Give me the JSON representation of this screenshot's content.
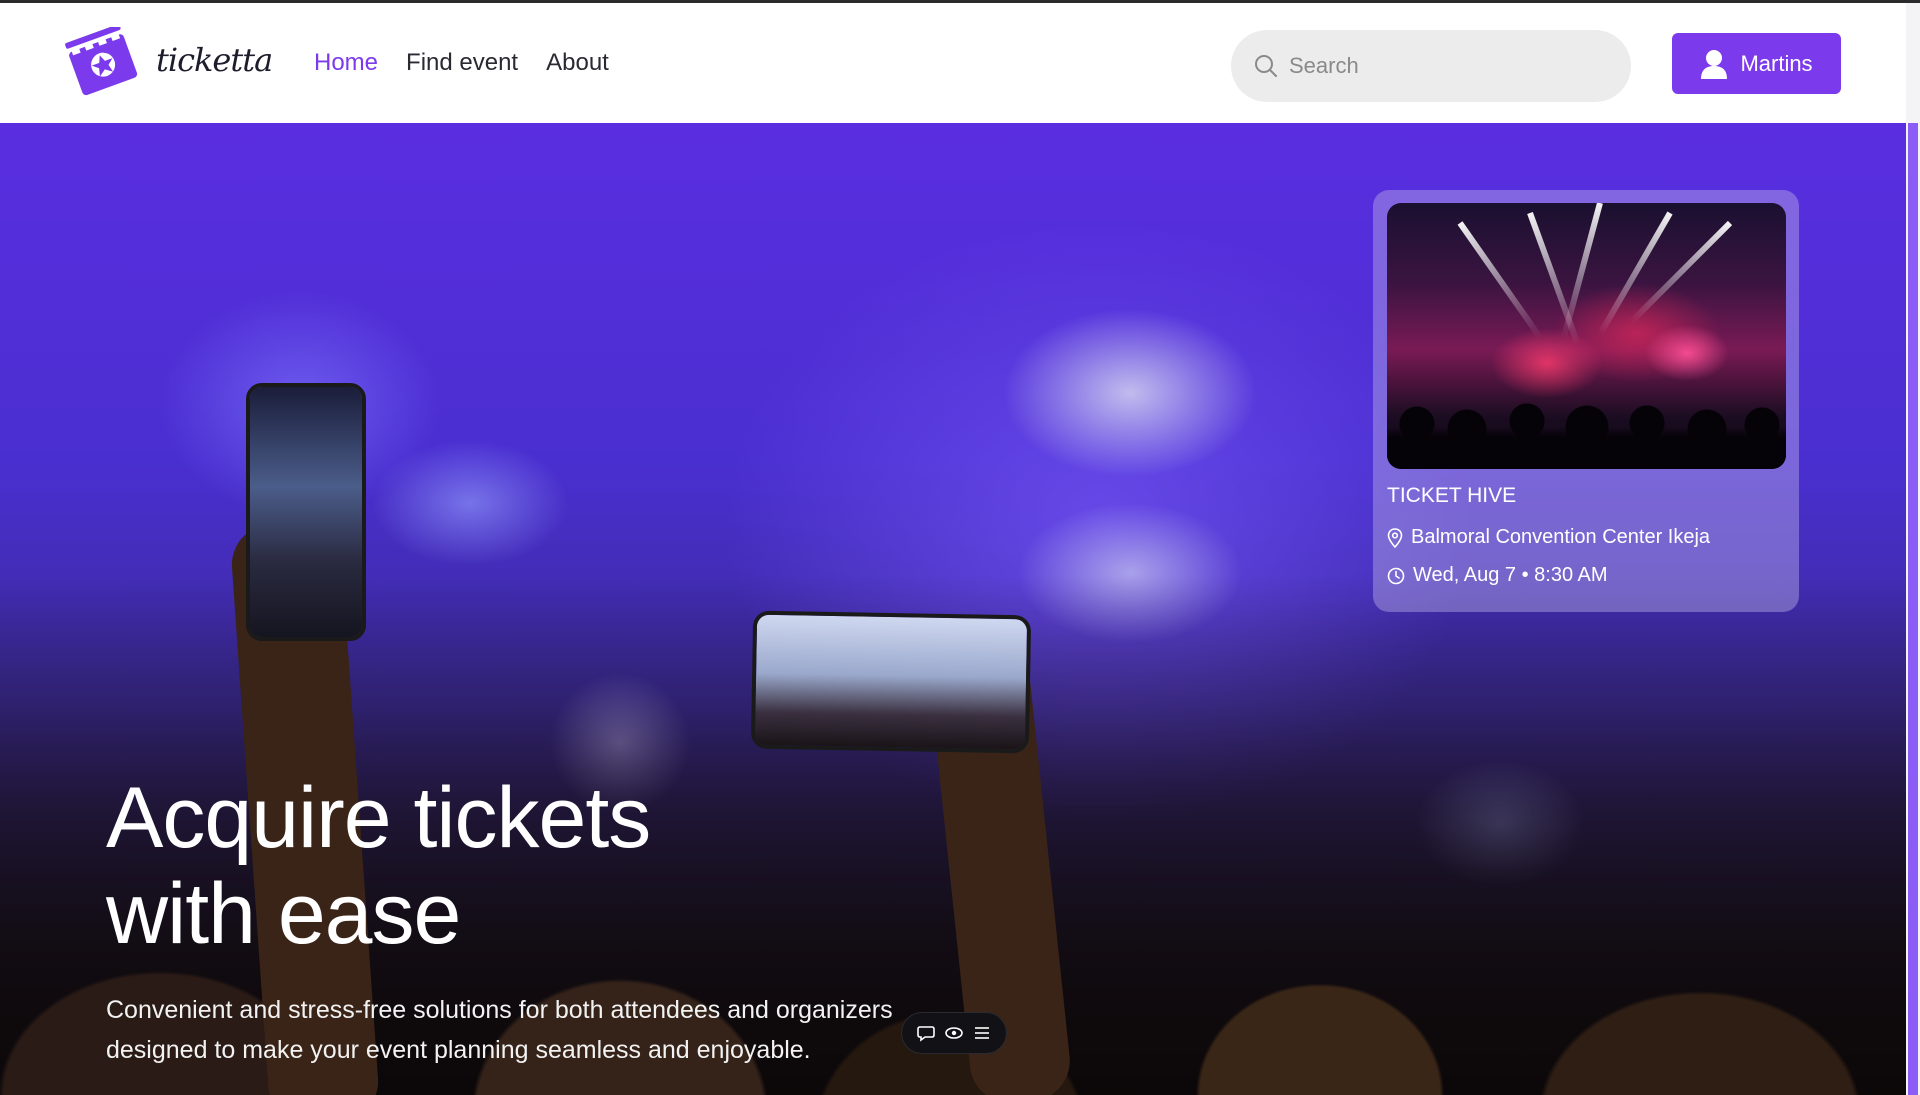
{
  "brand": {
    "name": "ticketta",
    "accent": "#7c3aed"
  },
  "nav": {
    "items": [
      {
        "label": "Home",
        "active": true
      },
      {
        "label": "Find event",
        "active": false
      },
      {
        "label": "About",
        "active": false
      }
    ]
  },
  "search": {
    "placeholder": "Search",
    "value": ""
  },
  "user": {
    "name": "Martins"
  },
  "event_card": {
    "title": "TICKET HIVE",
    "location": "Balmoral Convention Center Ikeja",
    "datetime": "Wed, Aug 7 • 8:30 AM"
  },
  "hero": {
    "title_line1": "Acquire tickets",
    "title_line2": "with ease",
    "subtitle_line1": "Convenient and stress-free solutions for both attendees and organizers",
    "subtitle_line2": "designed to make your event planning seamless and enjoyable."
  },
  "icons": {
    "logo": "ticket-star-icon",
    "search": "search-icon",
    "user": "user-icon",
    "location": "location-pin-icon",
    "time": "clock-icon",
    "toolbar": [
      "comment-icon",
      "eye-icon",
      "menu-icon"
    ]
  }
}
